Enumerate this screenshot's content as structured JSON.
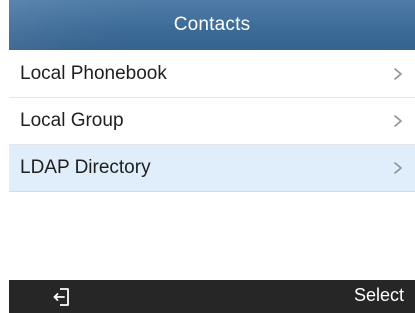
{
  "header": {
    "title": "Contacts"
  },
  "menu": {
    "items": [
      {
        "label": "Local Phonebook",
        "selected": false,
        "icon": "chevron-right-icon"
      },
      {
        "label": "Local Group",
        "selected": false,
        "icon": "chevron-right-icon"
      },
      {
        "label": "LDAP Directory",
        "selected": true,
        "icon": "chevron-right-icon"
      }
    ]
  },
  "softkeys": {
    "left_icon": "exit-icon",
    "right_label": "Select"
  },
  "colors": {
    "header_bg": "#3e6c99",
    "selected_bg": "#dfeefa",
    "softkey_bar_bg": "#262626",
    "text": "#1f1f1f",
    "chevron": "#8f9499"
  }
}
